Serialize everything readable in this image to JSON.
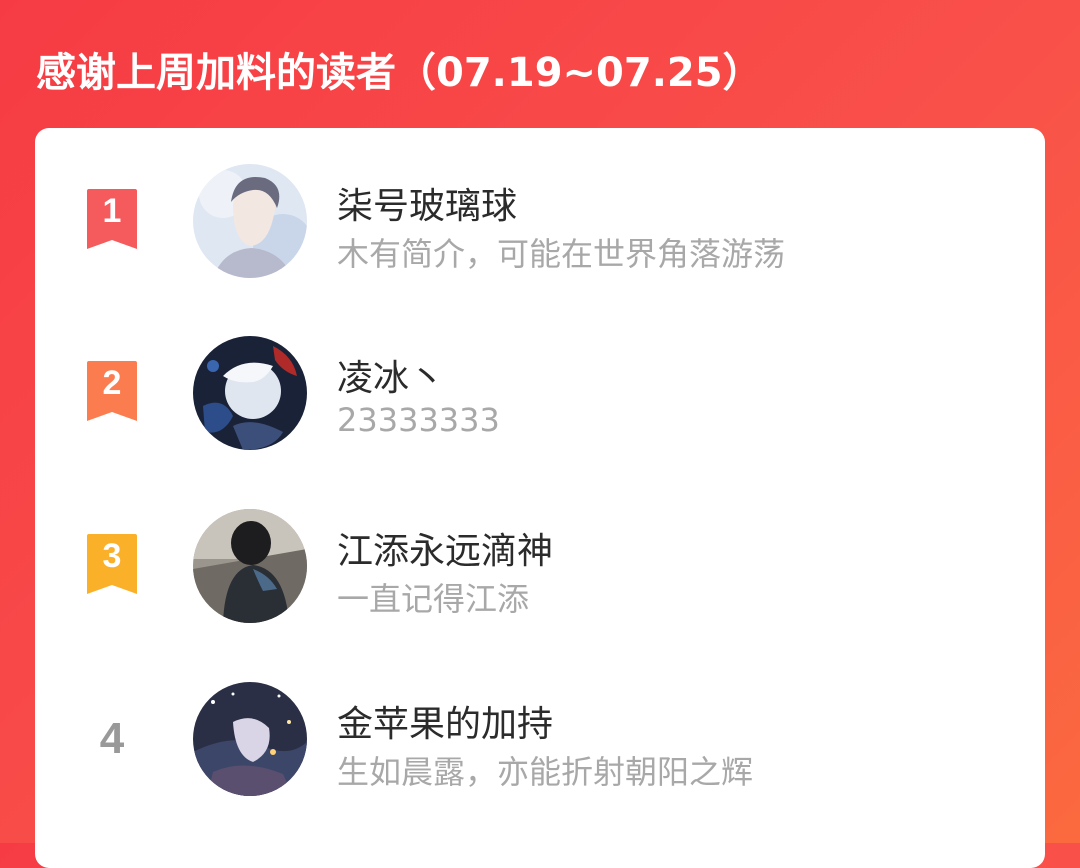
{
  "header": {
    "title": "感谢上周加料的读者（07.19~07.25）"
  },
  "colors": {
    "background_start": "#f63b44",
    "background_end": "#fb6a3f",
    "rank1": "#f55a5c",
    "rank2": "#fb7d4f",
    "rank3": "#fbb02a",
    "rank_plain": "#999999"
  },
  "readers": [
    {
      "rank": "1",
      "name": "柒号玻璃球",
      "bio": "木有简介，可能在世界角落游荡",
      "avatar": "avatar-portrait-sketch"
    },
    {
      "rank": "2",
      "name": "凌冰丶",
      "bio": "23333333",
      "avatar": "avatar-dark-anime"
    },
    {
      "rank": "3",
      "name": "江添永远滴神",
      "bio": "一直记得江添",
      "avatar": "avatar-hooded-figure"
    },
    {
      "rank": "4",
      "name": "金苹果的加持",
      "bio": "生如晨露，亦能折射朝阳之辉",
      "avatar": "avatar-night-sky"
    }
  ]
}
